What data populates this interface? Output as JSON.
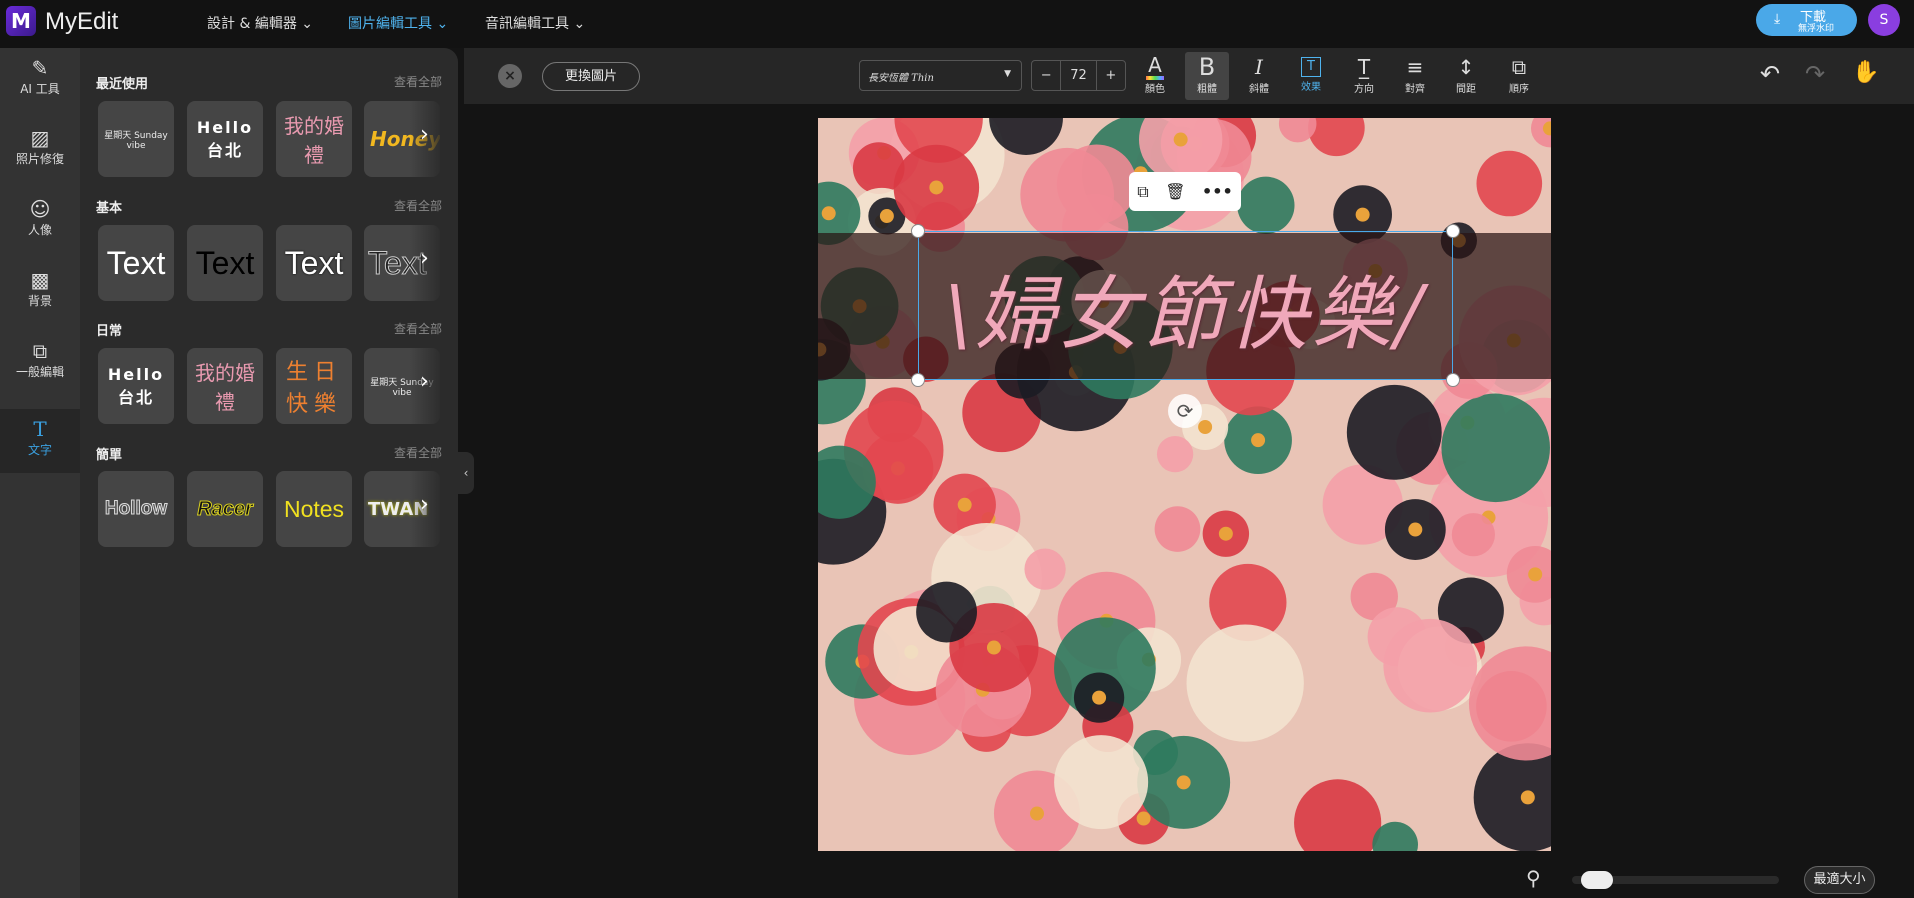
{
  "app": {
    "name": "MyEdit",
    "logo": "M"
  },
  "nav": [
    {
      "label": "設計 & 編輯器"
    },
    {
      "label": "圖片編輯工具"
    },
    {
      "label": "音訊編輯工具"
    }
  ],
  "download": {
    "label": "下載",
    "sub": "無浮水印"
  },
  "user": {
    "initial": "S"
  },
  "rail": [
    {
      "label": "AI 工具",
      "icon": "magic-wand-icon"
    },
    {
      "label": "照片修復",
      "icon": "photo-repair-icon"
    },
    {
      "label": "人像",
      "icon": "portrait-icon"
    },
    {
      "label": "背景",
      "icon": "background-icon"
    },
    {
      "label": "一般編輯",
      "icon": "general-edit-icon"
    },
    {
      "label": "文字",
      "icon": "text-icon"
    }
  ],
  "panel": {
    "see_all": "查看全部",
    "sections": [
      {
        "title": "最近使用",
        "cards": [
          "星期天 Sunday vibe",
          "Hello 台北",
          "我的婚禮",
          "Honey"
        ]
      },
      {
        "title": "基本",
        "cards": [
          "Text",
          "Text",
          "Text",
          "Text"
        ]
      },
      {
        "title": "日常",
        "cards": [
          "Hello 台北",
          "我的婚禮",
          "生日快樂",
          "星期天 Sunday vibe"
        ]
      },
      {
        "title": "簡單",
        "cards": [
          "Hollow",
          "Racer",
          "Notes",
          "TWAN"
        ]
      }
    ]
  },
  "toolbar": {
    "replace": "更換圖片",
    "font": "長安恆體 Thin",
    "size": "72",
    "minus": "−",
    "plus": "+",
    "tools": [
      {
        "label": "顏色",
        "g": "A"
      },
      {
        "label": "粗體",
        "g": "B"
      },
      {
        "label": "斜體",
        "g": "I"
      },
      {
        "label": "效果",
        "g": "T"
      },
      {
        "label": "方向",
        "g": "T̲"
      },
      {
        "label": "對齊",
        "g": "≡"
      },
      {
        "label": "間距",
        "g": "↕"
      },
      {
        "label": "順序",
        "g": "⧉"
      }
    ]
  },
  "canvas": {
    "text": "\\婦女節快樂/"
  },
  "zoom": {
    "level": 0.05,
    "fit": "最適大小"
  },
  "colors": {
    "accent": "#4fb3ee",
    "brand": "#6a2bd9"
  }
}
